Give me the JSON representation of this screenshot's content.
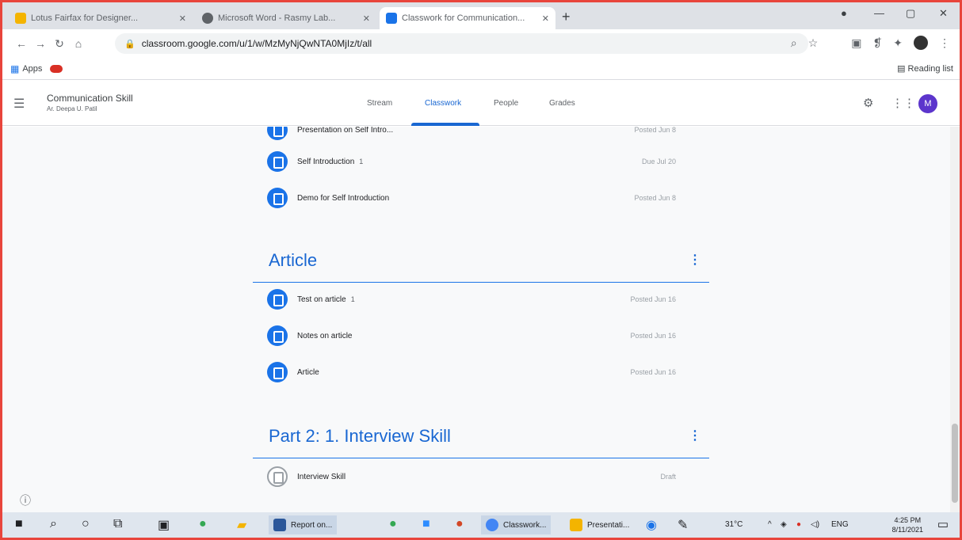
{
  "browser": {
    "tabs": [
      {
        "title": "Lotus Fairfax for Designer...",
        "favicon_color": "#f4b400",
        "active": false
      },
      {
        "title": "Microsoft Word - Rasmy Lab...",
        "favicon_color": "#5f6368",
        "active": false
      },
      {
        "title": "Classwork for Communication...",
        "favicon_color": "#1a73e8",
        "active": true
      }
    ],
    "new_tab_glyph": "+",
    "url": "classroom.google.com/u/1/w/MzMyNjQwNTA0MjIz/t/all",
    "bookmarks": {
      "apps_label": "Apps",
      "reading_list_label": "Reading list"
    }
  },
  "classroom": {
    "class_name": "Communication Skill",
    "class_subtitle": "Ar. Deepa U. Patil",
    "tabs": [
      "Stream",
      "Classwork",
      "People",
      "Grades"
    ],
    "active_tab": "Classwork",
    "avatar_initial": "M",
    "accent": "#1967d2"
  },
  "classwork": {
    "partial_item": {
      "title": "Presentation on Self Intro...",
      "date": "Posted Jun 8"
    },
    "items_before": [
      {
        "title": "Self Introduction",
        "attachment": "1",
        "date": "Due Jul 20"
      },
      {
        "title": "Demo for Self Introduction",
        "date": "Posted Jun 8"
      }
    ],
    "topics": [
      {
        "title": "Article",
        "items": [
          {
            "title": "Test on article",
            "attachment": "1",
            "date": "Posted Jun 16"
          },
          {
            "title": "Notes on article",
            "date": "Posted Jun 16"
          },
          {
            "title": "Article",
            "date": "Posted Jun 16"
          }
        ]
      },
      {
        "title": "Part 2: 1. Interview Skill",
        "items": [
          {
            "title": "Interview Skill",
            "date": "Draft"
          }
        ]
      }
    ]
  },
  "taskbar": {
    "apps": [
      {
        "label": "Report on...",
        "color": "#2b579a"
      },
      {
        "label": "Classwork...",
        "color": "#4285f4"
      },
      {
        "label": "Presentati...",
        "color": "#f4b400"
      }
    ],
    "temperature": "31°C",
    "language": "ENG",
    "time": "4:25 PM",
    "date": "8/11/2021"
  }
}
